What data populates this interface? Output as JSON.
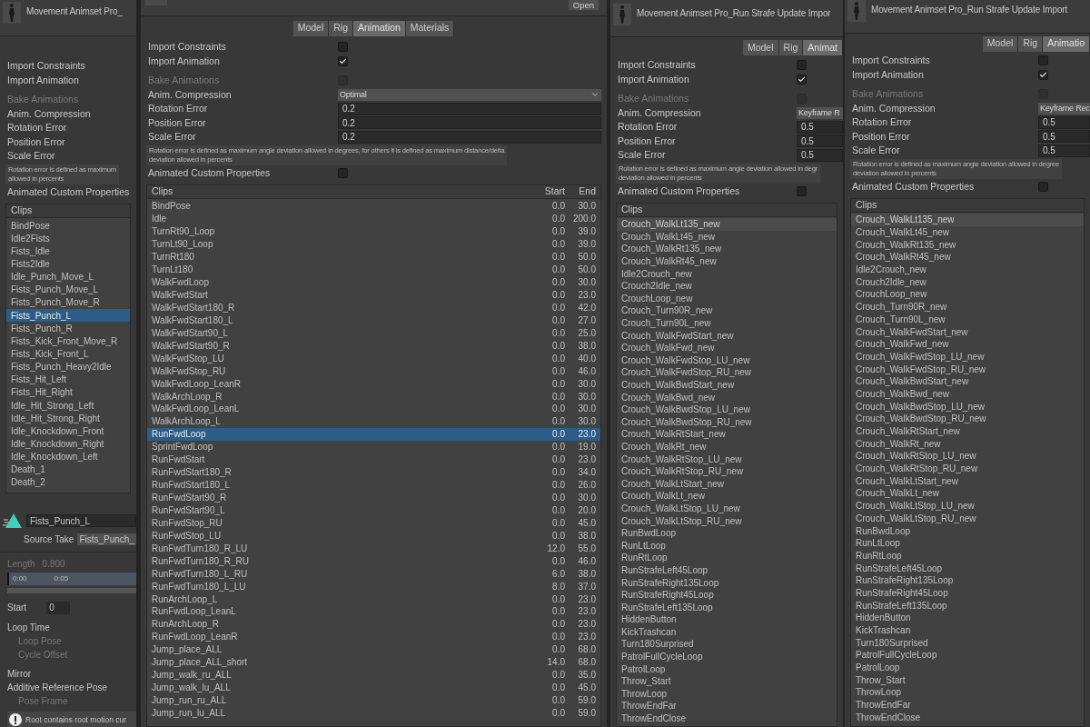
{
  "panels": [
    {
      "title": "Movement Animset Pro_",
      "settings": [
        {
          "kind": "label",
          "label": "Import Constraints",
          "disabled": false
        },
        {
          "kind": "label",
          "label": "Import Animation",
          "disabled": false
        },
        {
          "kind": "label",
          "label": "Bake Animations",
          "disabled": true
        },
        {
          "kind": "label",
          "label": "Anim. Compression",
          "disabled": false
        },
        {
          "kind": "label",
          "label": "Rotation Error",
          "disabled": false
        },
        {
          "kind": "label",
          "label": "Position Error",
          "disabled": false
        },
        {
          "kind": "label",
          "label": "Scale Error",
          "disabled": false
        }
      ],
      "help": [
        "Rotation error is defined as maximum",
        "allowed in percents"
      ],
      "custom_properties": {
        "kind": "label",
        "label": "Animated Custom Properties",
        "disabled": false
      },
      "clips": {
        "header": "Clips",
        "focused": true,
        "rows": [
          {
            "name": "BindPose",
            "selected": false
          },
          {
            "name": "Idle2Fists",
            "selected": false
          },
          {
            "name": "Fists_Idle",
            "selected": false
          },
          {
            "name": "Fists2Idle",
            "selected": false
          },
          {
            "name": "Idle_Punch_Move_L",
            "selected": false
          },
          {
            "name": "Fists_Punch_Move_L",
            "selected": false
          },
          {
            "name": "Fists_Punch_Move_R",
            "selected": false
          },
          {
            "name": "Fists_Punch_L",
            "selected": true
          },
          {
            "name": "Fists_Punch_R",
            "selected": false
          },
          {
            "name": "Fists_Kick_Front_Move_R",
            "selected": false
          },
          {
            "name": "Fists_Kick_Front_L",
            "selected": false
          },
          {
            "name": "Fists_Punch_Heavy2Idle",
            "selected": false
          },
          {
            "name": "Fists_Hit_Left",
            "selected": false
          },
          {
            "name": "Fists_Hit_Right",
            "selected": false
          },
          {
            "name": "Idle_Hit_Strong_Left",
            "selected": false
          },
          {
            "name": "Idle_Hit_Strong_Right",
            "selected": false
          },
          {
            "name": "Idle_Knockdown_Front",
            "selected": false
          },
          {
            "name": "Idle_Knockdown_Right",
            "selected": false
          },
          {
            "name": "Idle_Knockdown_Left",
            "selected": false
          },
          {
            "name": "Death_1",
            "selected": false
          },
          {
            "name": "Death_2",
            "selected": false
          }
        ]
      },
      "clip_detail": {
        "name": "Fists_Punch_L",
        "source_take_label": "Source Take",
        "source_take": "Fists_Punch_",
        "length_label": "Length",
        "length": "0.800",
        "timeline_marks": [
          "0:00",
          "0:05"
        ],
        "start_label": "Start",
        "start": "0",
        "options": [
          {
            "label": "Loop Time",
            "disabled": false
          },
          {
            "label": "Loop Pose",
            "disabled": true
          },
          {
            "label": "Cycle Offset",
            "disabled": true
          },
          {
            "label": "Mirror",
            "disabled": false
          },
          {
            "label": "Additive Reference Pose",
            "disabled": false
          },
          {
            "label": "Pose Frame",
            "disabled": true
          }
        ],
        "warning": "Root contains root motion cur"
      }
    },
    {
      "open_button": "Open",
      "tabs": [
        {
          "label": "Model",
          "selected": false
        },
        {
          "label": "Rig",
          "selected": false
        },
        {
          "label": "Animation",
          "selected": true
        },
        {
          "label": "Materials",
          "selected": false
        }
      ],
      "settings": [
        {
          "kind": "checkbox",
          "label": "Import Constraints",
          "checked": false,
          "disabled": false
        },
        {
          "kind": "checkbox",
          "label": "Import Animation",
          "checked": true,
          "disabled": false
        },
        {
          "kind": "checkbox",
          "label": "Bake Animations",
          "checked": false,
          "disabled": true
        },
        {
          "kind": "dropdown",
          "label": "Anim. Compression",
          "value": "Optimal",
          "disabled": false
        },
        {
          "kind": "number",
          "label": "Rotation Error",
          "value": "0.2",
          "disabled": false
        },
        {
          "kind": "number",
          "label": "Position Error",
          "value": "0.2",
          "disabled": false
        },
        {
          "kind": "number",
          "label": "Scale Error",
          "value": "0.2",
          "disabled": false
        }
      ],
      "help": [
        "Rotation error is defined as maximum angle deviation allowed in degrees, for others it is defined as maximum distance/delta",
        "deviation allowed in percents"
      ],
      "custom_properties": {
        "kind": "checkbox",
        "label": "Animated Custom Properties",
        "checked": false,
        "disabled": false
      },
      "clips": {
        "header": "Clips",
        "columns": [
          "Start",
          "End"
        ],
        "focused": true,
        "rows": [
          {
            "name": "BindPose",
            "start": "0.0",
            "end": "30.0",
            "selected": false
          },
          {
            "name": "Idle",
            "start": "0.0",
            "end": "200.0",
            "selected": false
          },
          {
            "name": "TurnRt90_Loop",
            "start": "0.0",
            "end": "39.0",
            "selected": false
          },
          {
            "name": "TurnLt90_Loop",
            "start": "0.0",
            "end": "39.0",
            "selected": false
          },
          {
            "name": "TurnRt180",
            "start": "0.0",
            "end": "50.0",
            "selected": false
          },
          {
            "name": "TurnLt180",
            "start": "0.0",
            "end": "50.0",
            "selected": false
          },
          {
            "name": "WalkFwdLoop",
            "start": "0.0",
            "end": "30.0",
            "selected": false
          },
          {
            "name": "WalkFwdStart",
            "start": "0.0",
            "end": "23.0",
            "selected": false
          },
          {
            "name": "WalkFwdStart180_R",
            "start": "0.0",
            "end": "42.0",
            "selected": false
          },
          {
            "name": "WalkFwdStart180_L",
            "start": "0.0",
            "end": "27.0",
            "selected": false
          },
          {
            "name": "WalkFwdStart90_L",
            "start": "0.0",
            "end": "25.0",
            "selected": false
          },
          {
            "name": "WalkFwdStart90_R",
            "start": "0.0",
            "end": "38.0",
            "selected": false
          },
          {
            "name": "WalkFwdStop_LU",
            "start": "0.0",
            "end": "40.0",
            "selected": false
          },
          {
            "name": "WalkFwdStop_RU",
            "start": "0.0",
            "end": "46.0",
            "selected": false
          },
          {
            "name": "WalkFwdLoop_LeanR",
            "start": "0.0",
            "end": "30.0",
            "selected": false
          },
          {
            "name": "WalkArchLoop_R",
            "start": "0.0",
            "end": "30.0",
            "selected": false
          },
          {
            "name": "WalkFwdLoop_LeanL",
            "start": "0.0",
            "end": "30.0",
            "selected": false
          },
          {
            "name": "WalkArchLoop_L",
            "start": "0.0",
            "end": "30.0",
            "selected": false
          },
          {
            "name": "RunFwdLoop",
            "start": "0.0",
            "end": "23.0",
            "selected": true
          },
          {
            "name": "SprintFwdLoop",
            "start": "0.0",
            "end": "19.0",
            "selected": false
          },
          {
            "name": "RunFwdStart",
            "start": "0.0",
            "end": "23.0",
            "selected": false
          },
          {
            "name": "RunFwdStart180_R",
            "start": "0.0",
            "end": "34.0",
            "selected": false
          },
          {
            "name": "RunFwdStart180_L",
            "start": "0.0",
            "end": "26.0",
            "selected": false
          },
          {
            "name": "RunFwdStart90_R",
            "start": "0.0",
            "end": "30.0",
            "selected": false
          },
          {
            "name": "RunFwdStart90_L",
            "start": "0.0",
            "end": "20.0",
            "selected": false
          },
          {
            "name": "RunFwdStop_RU",
            "start": "0.0",
            "end": "45.0",
            "selected": false
          },
          {
            "name": "RunFwdStop_LU",
            "start": "0.0",
            "end": "38.0",
            "selected": false
          },
          {
            "name": "RunFwdTurn180_R_LU",
            "start": "12.0",
            "end": "55.0",
            "selected": false
          },
          {
            "name": "RunFwdTurn180_R_RU",
            "start": "0.0",
            "end": "46.0",
            "selected": false
          },
          {
            "name": "RunFwdTurn180_L_RU",
            "start": "6.0",
            "end": "38.0",
            "selected": false
          },
          {
            "name": "RunFwdTurn180_L_LU",
            "start": "8.0",
            "end": "37.0",
            "selected": false
          },
          {
            "name": "RunArchLoop_L",
            "start": "0.0",
            "end": "23.0",
            "selected": false
          },
          {
            "name": "RunFwdLoop_LeanL",
            "start": "0.0",
            "end": "23.0",
            "selected": false
          },
          {
            "name": "RunArchLoop_R",
            "start": "0.0",
            "end": "23.0",
            "selected": false
          },
          {
            "name": "RunFwdLoop_LeanR",
            "start": "0.0",
            "end": "23.0",
            "selected": false
          },
          {
            "name": "Jump_place_ALL",
            "start": "0.0",
            "end": "68.0",
            "selected": false
          },
          {
            "name": "Jump_place_ALL_short",
            "start": "14.0",
            "end": "68.0",
            "selected": false
          },
          {
            "name": "Jump_walk_ru_ALL",
            "start": "0.0",
            "end": "35.0",
            "selected": false
          },
          {
            "name": "Jump_walk_lu_ALL",
            "start": "0.0",
            "end": "45.0",
            "selected": false
          },
          {
            "name": "Jump_run_ru_ALL",
            "start": "0.0",
            "end": "59.0",
            "selected": false
          },
          {
            "name": "Jump_run_lu_ALL",
            "start": "0.0",
            "end": "59.0",
            "selected": false
          }
        ]
      }
    },
    {
      "title": "Movement Animset Pro_Run Strafe Update Impor",
      "tabs": [
        {
          "label": "Model",
          "selected": false
        },
        {
          "label": "Rig",
          "selected": false
        },
        {
          "label": "Animat",
          "selected": true
        }
      ],
      "settings": [
        {
          "kind": "checkbox",
          "label": "Import Constraints",
          "checked": false,
          "disabled": false
        },
        {
          "kind": "checkbox",
          "label": "Import Animation",
          "checked": true,
          "disabled": false
        },
        {
          "kind": "checkbox",
          "label": "Bake Animations",
          "checked": false,
          "disabled": true
        },
        {
          "kind": "dropdown",
          "label": "Anim. Compression",
          "value": "Keyframe R",
          "disabled": false
        },
        {
          "kind": "number",
          "label": "Rotation Error",
          "value": "0.5",
          "disabled": false
        },
        {
          "kind": "number",
          "label": "Position Error",
          "value": "0.5",
          "disabled": false
        },
        {
          "kind": "number",
          "label": "Scale Error",
          "value": "0.5",
          "disabled": false
        }
      ],
      "help": [
        "Rotation error is defined as maximum angle deviation allowed in degr",
        "deviation allowed in percents"
      ],
      "custom_properties": {
        "kind": "checkbox",
        "label": "Animated Custom Properties",
        "checked": false,
        "disabled": false
      },
      "clips": {
        "header": "Clips",
        "focused": false,
        "rows": [
          {
            "name": "Crouch_WalkLt135_new",
            "selected": true
          },
          {
            "name": "Crouch_WalkLt45_new",
            "selected": false
          },
          {
            "name": "Crouch_WalkRt135_new",
            "selected": false
          },
          {
            "name": "Crouch_WalkRt45_new",
            "selected": false
          },
          {
            "name": "Idle2Crouch_new",
            "selected": false
          },
          {
            "name": "Crouch2Idle_new",
            "selected": false
          },
          {
            "name": "CrouchLoop_new",
            "selected": false
          },
          {
            "name": "Crouch_Turn90R_new",
            "selected": false
          },
          {
            "name": "Crouch_Turn90L_new",
            "selected": false
          },
          {
            "name": "Crouch_WalkFwdStart_new",
            "selected": false
          },
          {
            "name": "Crouch_WalkFwd_new",
            "selected": false
          },
          {
            "name": "Crouch_WalkFwdStop_LU_new",
            "selected": false
          },
          {
            "name": "Crouch_WalkFwdStop_RU_new",
            "selected": false
          },
          {
            "name": "Crouch_WalkBwdStart_new",
            "selected": false
          },
          {
            "name": "Crouch_WalkBwd_new",
            "selected": false
          },
          {
            "name": "Crouch_WalkBwdStop_LU_new",
            "selected": false
          },
          {
            "name": "Crouch_WalkBwdStop_RU_new",
            "selected": false
          },
          {
            "name": "Crouch_WalkRtStart_new",
            "selected": false
          },
          {
            "name": "Crouch_WalkRt_new",
            "selected": false
          },
          {
            "name": "Crouch_WalkRtStop_LU_new",
            "selected": false
          },
          {
            "name": "Crouch_WalkRtStop_RU_new",
            "selected": false
          },
          {
            "name": "Crouch_WalkLtStart_new",
            "selected": false
          },
          {
            "name": "Crouch_WalkLt_new",
            "selected": false
          },
          {
            "name": "Crouch_WalkLtStop_LU_new",
            "selected": false
          },
          {
            "name": "Crouch_WalkLtStop_RU_new",
            "selected": false
          },
          {
            "name": "RunBwdLoop",
            "selected": false
          },
          {
            "name": "RunLtLoop",
            "selected": false
          },
          {
            "name": "RunRtLoop",
            "selected": false
          },
          {
            "name": "RunStrafeLeft45Loop",
            "selected": false
          },
          {
            "name": "RunStrafeRight135Loop",
            "selected": false
          },
          {
            "name": "RunStrafeRight45Loop",
            "selected": false
          },
          {
            "name": "RunStrafeLeft135Loop",
            "selected": false
          },
          {
            "name": "HiddenButton",
            "selected": false
          },
          {
            "name": "KickTrashcan",
            "selected": false
          },
          {
            "name": "Turn180Surprised",
            "selected": false
          },
          {
            "name": "PatrolFullCycleLoop",
            "selected": false
          },
          {
            "name": "PatrolLoop",
            "selected": false
          },
          {
            "name": "Throw_Start",
            "selected": false
          },
          {
            "name": "ThrowLoop",
            "selected": false
          },
          {
            "name": "ThrowEndFar",
            "selected": false
          },
          {
            "name": "ThrowEndClose",
            "selected": false
          }
        ]
      }
    },
    {
      "title": "Movement Animset Pro_Run Strafe Update Import",
      "tabs": [
        {
          "label": "Model",
          "selected": false
        },
        {
          "label": "Rig",
          "selected": false
        },
        {
          "label": "Animatio",
          "selected": true
        }
      ],
      "settings": [
        {
          "kind": "checkbox",
          "label": "Import Constraints",
          "checked": false,
          "disabled": false
        },
        {
          "kind": "checkbox",
          "label": "Import Animation",
          "checked": true,
          "disabled": false
        },
        {
          "kind": "checkbox",
          "label": "Bake Animations",
          "checked": false,
          "disabled": true
        },
        {
          "kind": "dropdown",
          "label": "Anim. Compression",
          "value": "Keyframe Rec",
          "disabled": false
        },
        {
          "kind": "number",
          "label": "Rotation Error",
          "value": "0.5",
          "disabled": false
        },
        {
          "kind": "number",
          "label": "Position Error",
          "value": "0.5",
          "disabled": false
        },
        {
          "kind": "number",
          "label": "Scale Error",
          "value": "0.5",
          "disabled": false
        }
      ],
      "help": [
        "Rotation error is defined as maximum angle deviation allowed in degree",
        "deviation allowed in percents"
      ],
      "custom_properties": {
        "kind": "checkbox",
        "label": "Animated Custom Properties",
        "checked": false,
        "disabled": false
      },
      "clips": {
        "header": "Clips",
        "focused": false,
        "rows": [
          {
            "name": "Crouch_WalkLt135_new",
            "selected": true
          },
          {
            "name": "Crouch_WalkLt45_new",
            "selected": false
          },
          {
            "name": "Crouch_WalkRt135_new",
            "selected": false
          },
          {
            "name": "Crouch_WalkRt45_new",
            "selected": false
          },
          {
            "name": "Idle2Crouch_new",
            "selected": false
          },
          {
            "name": "Crouch2Idle_new",
            "selected": false
          },
          {
            "name": "CrouchLoop_new",
            "selected": false
          },
          {
            "name": "Crouch_Turn90R_new",
            "selected": false
          },
          {
            "name": "Crouch_Turn90L_new",
            "selected": false
          },
          {
            "name": "Crouch_WalkFwdStart_new",
            "selected": false
          },
          {
            "name": "Crouch_WalkFwd_new",
            "selected": false
          },
          {
            "name": "Crouch_WalkFwdStop_LU_new",
            "selected": false
          },
          {
            "name": "Crouch_WalkFwdStop_RU_new",
            "selected": false
          },
          {
            "name": "Crouch_WalkBwdStart_new",
            "selected": false
          },
          {
            "name": "Crouch_WalkBwd_new",
            "selected": false
          },
          {
            "name": "Crouch_WalkBwdStop_LU_new",
            "selected": false
          },
          {
            "name": "Crouch_WalkBwdStop_RU_new",
            "selected": false
          },
          {
            "name": "Crouch_WalkRtStart_new",
            "selected": false
          },
          {
            "name": "Crouch_WalkRt_new",
            "selected": false
          },
          {
            "name": "Crouch_WalkRtStop_LU_new",
            "selected": false
          },
          {
            "name": "Crouch_WalkRtStop_RU_new",
            "selected": false
          },
          {
            "name": "Crouch_WalkLtStart_new",
            "selected": false
          },
          {
            "name": "Crouch_WalkLt_new",
            "selected": false
          },
          {
            "name": "Crouch_WalkLtStop_LU_new",
            "selected": false
          },
          {
            "name": "Crouch_WalkLtStop_RU_new",
            "selected": false
          },
          {
            "name": "RunBwdLoop",
            "selected": false
          },
          {
            "name": "RunLtLoop",
            "selected": false
          },
          {
            "name": "RunRtLoop",
            "selected": false
          },
          {
            "name": "RunStrafeLeft45Loop",
            "selected": false
          },
          {
            "name": "RunStrafeRight135Loop",
            "selected": false
          },
          {
            "name": "RunStrafeRight45Loop",
            "selected": false
          },
          {
            "name": "RunStrafeLeft135Loop",
            "selected": false
          },
          {
            "name": "HiddenButton",
            "selected": false
          },
          {
            "name": "KickTrashcan",
            "selected": false
          },
          {
            "name": "Turn180Surprised",
            "selected": false
          },
          {
            "name": "PatrolFullCycleLoop",
            "selected": false
          },
          {
            "name": "PatrolLoop",
            "selected": false
          },
          {
            "name": "Throw_Start",
            "selected": false
          },
          {
            "name": "ThrowLoop",
            "selected": false
          },
          {
            "name": "ThrowEndFar",
            "selected": false
          },
          {
            "name": "ThrowEndClose",
            "selected": false
          }
        ]
      }
    }
  ]
}
